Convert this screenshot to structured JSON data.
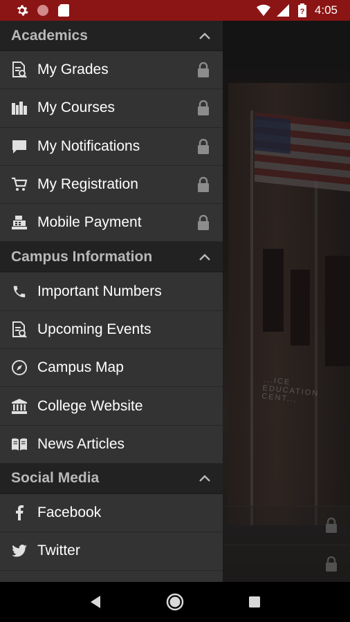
{
  "status_bar": {
    "time": "4:05",
    "icons": [
      "gear-icon",
      "circle-icon",
      "sd-card-icon",
      "wifi-icon",
      "signal-icon",
      "battery-icon"
    ],
    "color": "#8b1414"
  },
  "drawer": {
    "sections": [
      {
        "title": "Academics",
        "items": [
          {
            "label": "My Grades",
            "icon": "grades-doc-icon",
            "locked": true
          },
          {
            "label": "My Courses",
            "icon": "books-icon",
            "locked": true
          },
          {
            "label": "My Notifications",
            "icon": "chat-bubble-icon",
            "locked": true
          },
          {
            "label": "My Registration",
            "icon": "cart-icon",
            "locked": true
          },
          {
            "label": "Mobile Payment",
            "icon": "cash-register-icon",
            "locked": true
          }
        ]
      },
      {
        "title": "Campus Information",
        "items": [
          {
            "label": "Important Numbers",
            "icon": "phone-icon",
            "locked": false
          },
          {
            "label": "Upcoming Events",
            "icon": "events-doc-icon",
            "locked": false
          },
          {
            "label": "Campus Map",
            "icon": "compass-icon",
            "locked": false
          },
          {
            "label": "College Website",
            "icon": "institution-icon",
            "locked": false
          },
          {
            "label": "News Articles",
            "icon": "open-book-icon",
            "locked": false
          }
        ]
      },
      {
        "title": "Social Media",
        "items": [
          {
            "label": "Facebook",
            "icon": "facebook-icon",
            "locked": false
          },
          {
            "label": "Twitter",
            "icon": "twitter-icon",
            "locked": false
          }
        ]
      }
    ]
  },
  "background": {
    "sign_text": "...ICE EDUCATION CENT..."
  },
  "colors": {
    "drawer_bg": "#333333",
    "section_bg": "#222222",
    "section_text": "#b9b9b9",
    "item_text": "#ffffff",
    "icon": "#e0e0e0",
    "lock": "#8c8c8c"
  }
}
